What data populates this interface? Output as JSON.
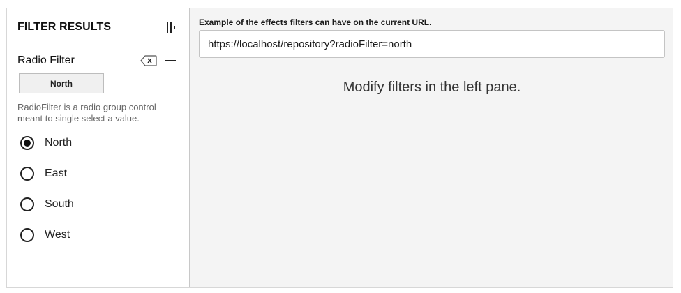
{
  "sidebar": {
    "title": "FILTER RESULTS",
    "filter": {
      "label": "Radio Filter",
      "selected_chip": "North",
      "description": "RadioFilter is a radio group control meant to single select a value.",
      "options": [
        {
          "label": "North",
          "selected": true
        },
        {
          "label": "East",
          "selected": false
        },
        {
          "label": "South",
          "selected": false
        },
        {
          "label": "West",
          "selected": false
        }
      ]
    }
  },
  "main": {
    "url_caption": "Example of the effects filters can have on the current URL.",
    "url_value": "https://localhost/repository?radioFilter=north",
    "message": "Modify filters in the left pane."
  },
  "icons": {
    "collapse": "collapse-sidebar-icon",
    "clear": "clear-filter-icon",
    "minimize": "minus-icon"
  }
}
